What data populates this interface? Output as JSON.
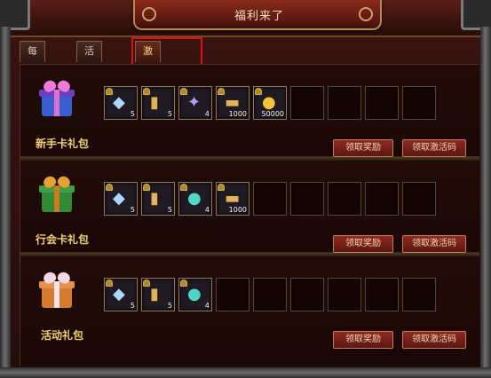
{
  "window": {
    "title": "福利来了"
  },
  "tabs": [
    {
      "label": "每日签到",
      "active": false
    },
    {
      "label": "活跃奖励",
      "active": false
    },
    {
      "label": "激活礼包",
      "active": true
    }
  ],
  "highlight_color": "#e01010",
  "packages": [
    {
      "label": "新手卡礼包",
      "gift_color": "blue",
      "items": [
        {
          "icon": "crystal-icon",
          "count": "5"
        },
        {
          "icon": "scroll-icon",
          "count": "5"
        },
        {
          "icon": "feather-icon",
          "count": "4"
        },
        {
          "icon": "scroll-icon",
          "count": "1000"
        },
        {
          "icon": "coin-icon",
          "count": "50000"
        }
      ],
      "empty_slots": 4,
      "claim_button": "领取奖励",
      "code_button": "领取激活码"
    },
    {
      "label": "行会卡礼包",
      "gift_color": "green",
      "items": [
        {
          "icon": "crystal-icon",
          "count": "5"
        },
        {
          "icon": "scroll-icon",
          "count": "5"
        },
        {
          "icon": "potion-icon",
          "count": "4"
        },
        {
          "icon": "scroll-icon",
          "count": "1000"
        }
      ],
      "empty_slots": 5,
      "claim_button": "领取奖励",
      "code_button": "领取激活码"
    },
    {
      "label": "活动礼包",
      "gift_color": "orange",
      "items": [
        {
          "icon": "crystal-icon",
          "count": "5"
        },
        {
          "icon": "scroll-icon",
          "count": "5"
        },
        {
          "icon": "potion-icon",
          "count": "4"
        }
      ],
      "empty_slots": 6,
      "claim_button": "领取奖励",
      "code_button": "领取激活码"
    }
  ]
}
